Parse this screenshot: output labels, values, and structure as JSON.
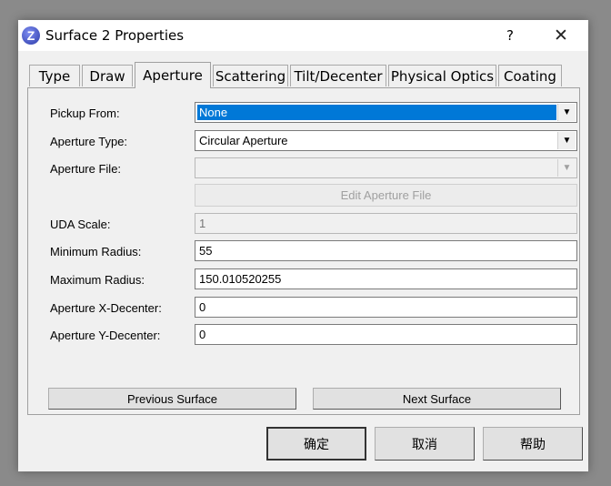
{
  "window": {
    "title": "Surface 2 Properties",
    "icon_letter": "Z",
    "help_label": "?",
    "close_label": "✕"
  },
  "tabs": [
    {
      "label": "Type",
      "active": false
    },
    {
      "label": "Draw",
      "active": false
    },
    {
      "label": "Aperture",
      "active": true
    },
    {
      "label": "Scattering",
      "active": false
    },
    {
      "label": "Tilt/Decenter",
      "active": false
    },
    {
      "label": "Physical Optics",
      "active": false
    },
    {
      "label": "Coating",
      "active": false
    }
  ],
  "form": {
    "pickup_from": {
      "label": "Pickup From:",
      "value": "None"
    },
    "aperture_type": {
      "label": "Aperture Type:",
      "value": "Circular Aperture"
    },
    "aperture_file": {
      "label": "Aperture File:",
      "value": ""
    },
    "edit_aperture_file": {
      "label": "Edit Aperture File"
    },
    "uda_scale": {
      "label": "UDA Scale:",
      "value": "1"
    },
    "minimum_radius": {
      "label": "Minimum Radius:",
      "value": "55"
    },
    "maximum_radius": {
      "label": "Maximum Radius:",
      "value": "150.010520255"
    },
    "aperture_x_decenter": {
      "label": "Aperture X-Decenter:",
      "value": "0"
    },
    "aperture_y_decenter": {
      "label": "Aperture Y-Decenter:",
      "value": "0"
    }
  },
  "nav": {
    "previous_surface": "Previous Surface",
    "next_surface": "Next Surface"
  },
  "buttons": {
    "ok": "确定",
    "cancel": "取消",
    "help": "帮助"
  },
  "colors": {
    "selection": "#0078d7",
    "dialog_bg": "#f0f0f0"
  },
  "icons": {
    "dropdown": "chevron-down-icon",
    "close": "close-icon",
    "help": "help-icon"
  }
}
